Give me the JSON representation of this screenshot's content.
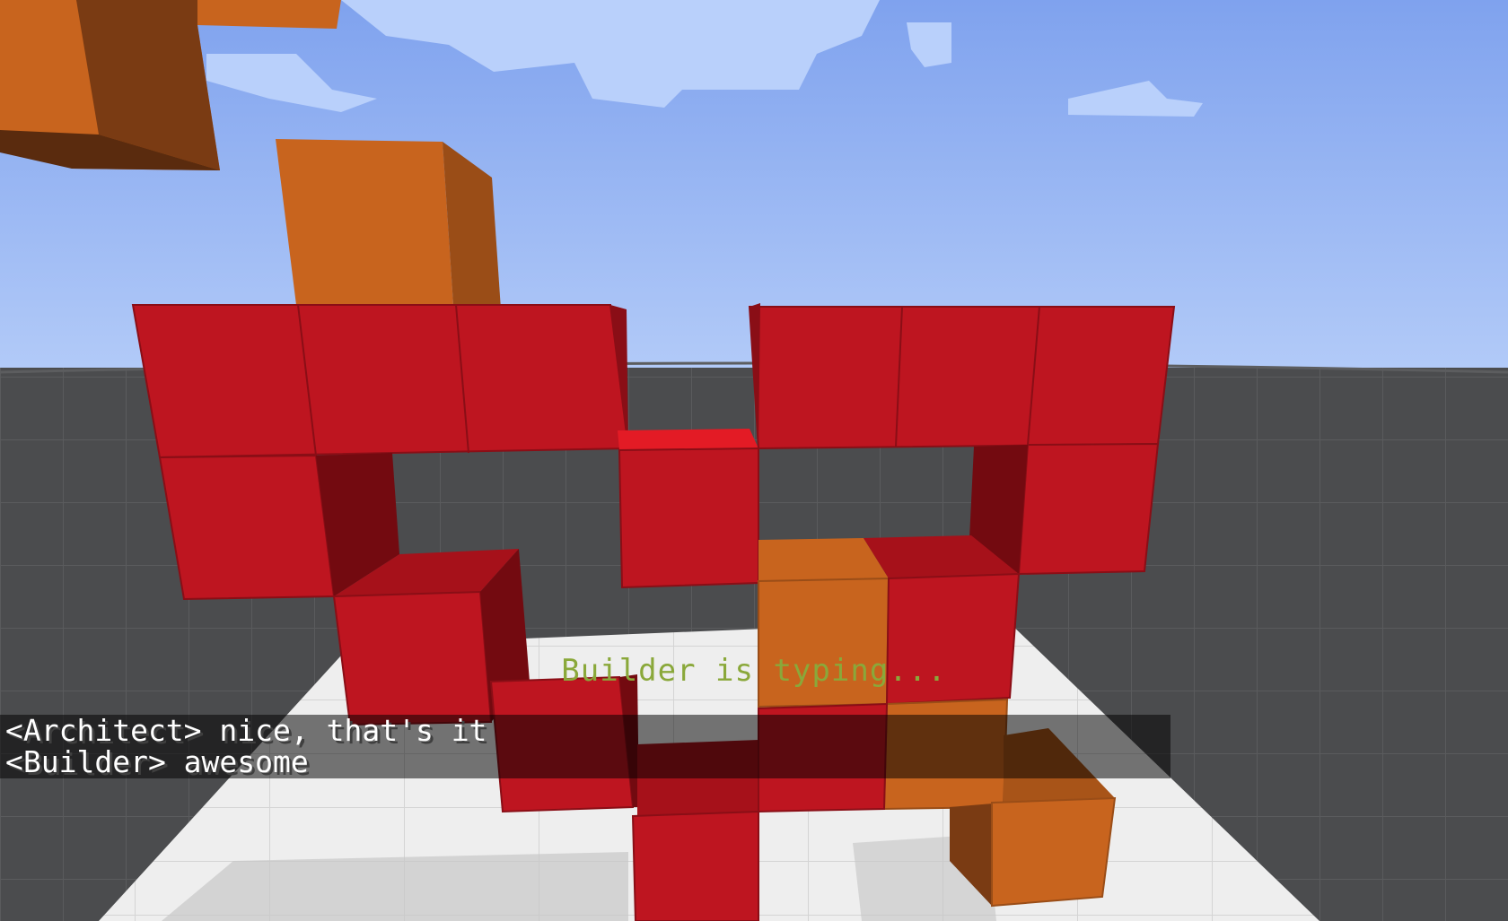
{
  "overlay": {
    "typing_indicator": "Builder is typing...",
    "typing_color": "#8aa83a"
  },
  "chat": {
    "messages": [
      {
        "text": "<Architect> nice, that's it"
      },
      {
        "text": "<Builder> awesome"
      }
    ]
  },
  "scene": {
    "sky_color": "#9bb6f5",
    "ground_color": "#4a4b4d",
    "platform_color": "#e8e8e8",
    "block_colors": {
      "red": "#be1520",
      "orange": "#c8641e"
    }
  }
}
